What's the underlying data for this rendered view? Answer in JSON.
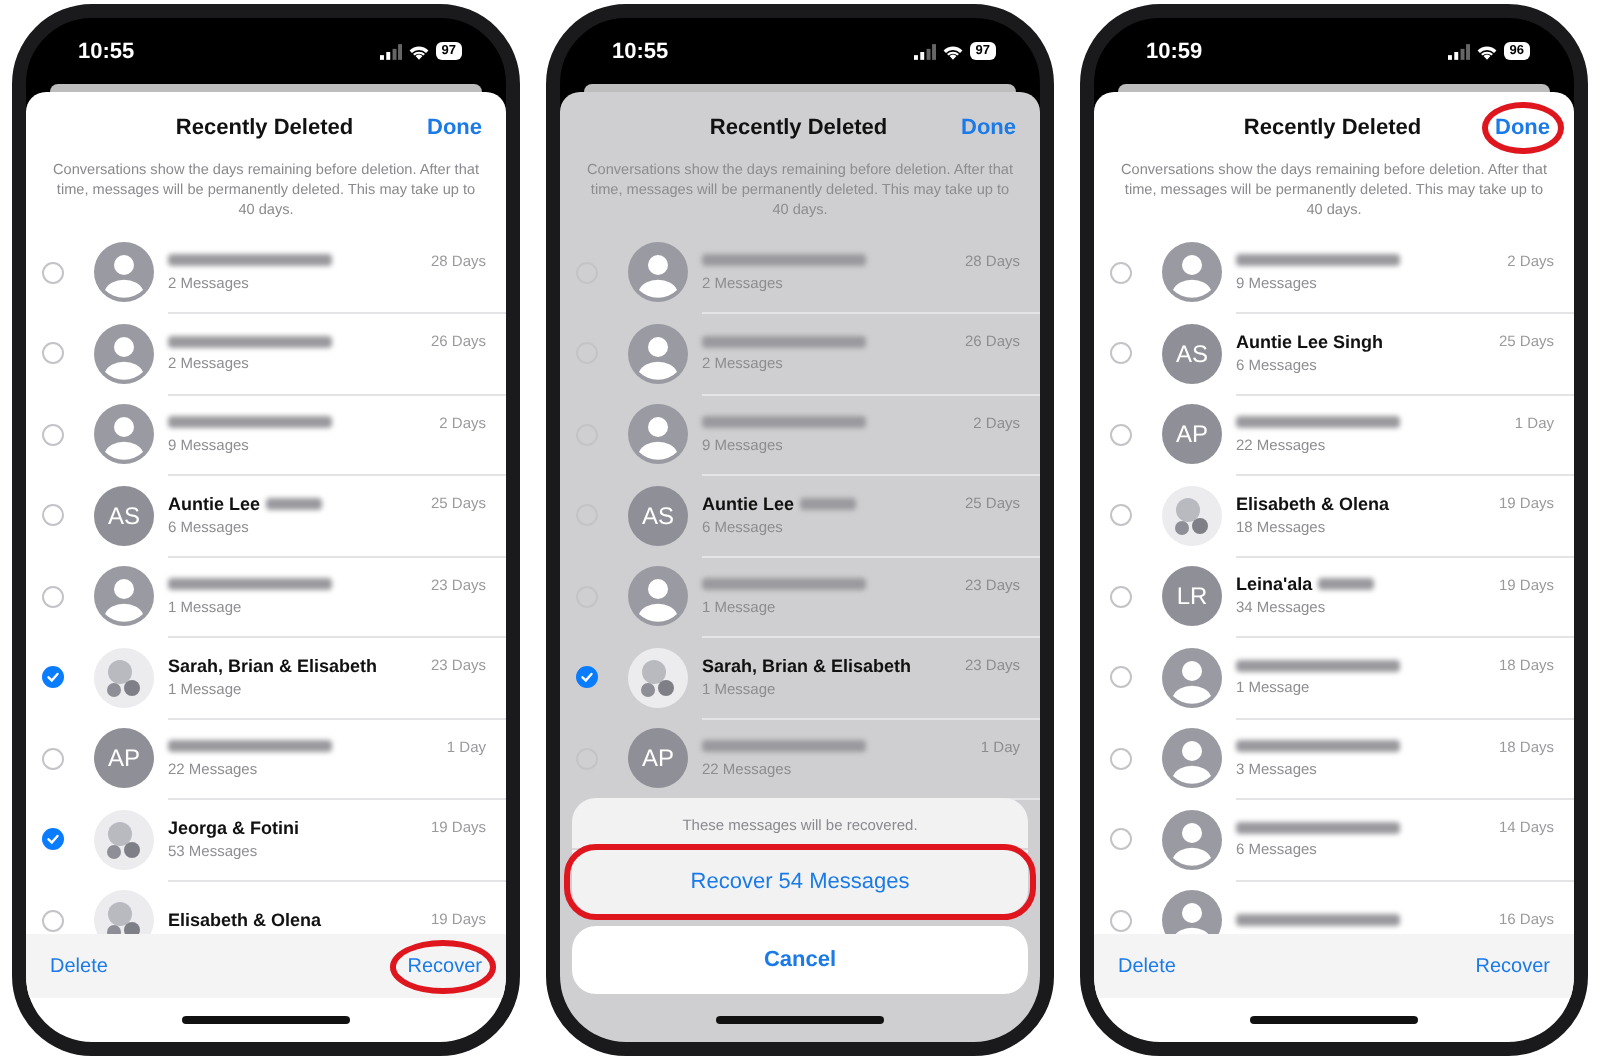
{
  "phones": [
    {
      "status_bar": {
        "time": "10:55",
        "battery": "97"
      },
      "dimmed": false,
      "title": "Recently Deleted",
      "done": {
        "label": "Done",
        "highlighted": false
      },
      "description": "Conversations show the days remaining before deletion. After that time, messages will be permanently deleted. This may take up to 40 days.",
      "rows": [
        {
          "name_blurred": true,
          "messages": "2 Messages",
          "days": "28 Days",
          "checked": false,
          "avatar": {
            "kind": "person"
          }
        },
        {
          "name_blurred": true,
          "messages": "2 Messages",
          "days": "26 Days",
          "checked": false,
          "avatar": {
            "kind": "person"
          }
        },
        {
          "name_blurred": true,
          "messages": "9 Messages",
          "days": "2 Days",
          "checked": false,
          "avatar": {
            "kind": "person"
          }
        },
        {
          "name": "Auntie Lee",
          "name_blurred": true,
          "messages": "6 Messages",
          "days": "25 Days",
          "checked": false,
          "avatar": {
            "kind": "initials",
            "initials": "AS"
          }
        },
        {
          "name_blurred": true,
          "messages": "1 Message",
          "days": "23 Days",
          "checked": false,
          "avatar": {
            "kind": "person"
          }
        },
        {
          "name": "Sarah, Brian & Elisabeth",
          "name_blurred": false,
          "messages": "1 Message",
          "days": "23 Days",
          "checked": true,
          "avatar": {
            "kind": "group"
          }
        },
        {
          "name_blurred": true,
          "messages": "22 Messages",
          "days": "1 Day",
          "checked": false,
          "avatar": {
            "kind": "initials",
            "initials": "AP"
          }
        },
        {
          "name": "Jeorga  & Fotini",
          "name_blurred": false,
          "messages": "53 Messages",
          "days": "19 Days",
          "checked": true,
          "avatar": {
            "kind": "group"
          }
        },
        {
          "name": "Elisabeth & Olena",
          "name_blurred": false,
          "days": "19 Days",
          "checked": false,
          "avatar": {
            "kind": "group"
          }
        }
      ],
      "toolbar": {
        "delete": {
          "label": "Delete"
        },
        "recover": {
          "label": "Recover",
          "highlighted": true
        }
      }
    },
    {
      "status_bar": {
        "time": "10:55",
        "battery": "97"
      },
      "dimmed": true,
      "title": "Recently Deleted",
      "done": {
        "label": "Done",
        "highlighted": false
      },
      "description": "Conversations show the days remaining before deletion. After that time, messages will be permanently deleted. This may take up to 40 days.",
      "rows": [
        {
          "name_blurred": true,
          "messages": "2 Messages",
          "days": "28 Days",
          "checked": false,
          "avatar": {
            "kind": "person"
          }
        },
        {
          "name_blurred": true,
          "messages": "2 Messages",
          "days": "26 Days",
          "checked": false,
          "avatar": {
            "kind": "person"
          }
        },
        {
          "name_blurred": true,
          "messages": "9 Messages",
          "days": "2 Days",
          "checked": false,
          "avatar": {
            "kind": "person"
          }
        },
        {
          "name": "Auntie Lee",
          "name_blurred": true,
          "messages": "6 Messages",
          "days": "25 Days",
          "checked": false,
          "avatar": {
            "kind": "initials",
            "initials": "AS"
          }
        },
        {
          "name_blurred": true,
          "messages": "1 Message",
          "days": "23 Days",
          "checked": false,
          "avatar": {
            "kind": "person"
          }
        },
        {
          "name": "Sarah, Brian & Elisabeth",
          "name_blurred": false,
          "messages": "1 Message",
          "days": "23 Days",
          "checked": true,
          "avatar": {
            "kind": "group"
          }
        },
        {
          "name_blurred": true,
          "messages": "22 Messages",
          "days": "1 Day",
          "checked": false,
          "avatar": {
            "kind": "initials",
            "initials": "AP"
          }
        }
      ],
      "action_sheet": {
        "message": "These messages will be recovered.",
        "action": {
          "label": "Recover 54 Messages",
          "highlighted": true
        },
        "cancel": {
          "label": "Cancel"
        }
      }
    },
    {
      "status_bar": {
        "time": "10:59",
        "battery": "96"
      },
      "dimmed": false,
      "title": "Recently Deleted",
      "done": {
        "label": "Done",
        "highlighted": true
      },
      "description": "Conversations show the days remaining before deletion. After that time, messages will be permanently deleted. This may take up to 40 days.",
      "rows": [
        {
          "name_blurred": true,
          "messages": "9 Messages",
          "days": "2 Days",
          "checked": false,
          "avatar": {
            "kind": "person"
          }
        },
        {
          "name": "Auntie Lee Singh",
          "name_blurred": false,
          "messages": "6 Messages",
          "days": "25 Days",
          "checked": false,
          "avatar": {
            "kind": "initials",
            "initials": "AS"
          }
        },
        {
          "name_blurred": true,
          "messages": "22 Messages",
          "days": "1 Day",
          "checked": false,
          "avatar": {
            "kind": "initials",
            "initials": "AP"
          }
        },
        {
          "name": "Elisabeth & Olena",
          "name_blurred": false,
          "messages": "18 Messages",
          "days": "19 Days",
          "checked": false,
          "avatar": {
            "kind": "group"
          }
        },
        {
          "name": "Leina'ala",
          "name_blurred": true,
          "messages": "34 Messages",
          "days": "19 Days",
          "checked": false,
          "avatar": {
            "kind": "initials",
            "initials": "LR"
          }
        },
        {
          "name_blurred": true,
          "messages": "1 Message",
          "days": "18 Days",
          "checked": false,
          "avatar": {
            "kind": "person"
          }
        },
        {
          "name_blurred": true,
          "messages": "3 Messages",
          "days": "18 Days",
          "checked": false,
          "avatar": {
            "kind": "person"
          }
        },
        {
          "name_blurred": true,
          "messages": "6 Messages",
          "days": "14 Days",
          "checked": false,
          "avatar": {
            "kind": "person"
          }
        },
        {
          "name_blurred": true,
          "days": "16 Days",
          "checked": false,
          "avatar": {
            "kind": "person"
          }
        }
      ],
      "toolbar": {
        "delete": {
          "label": "Delete"
        },
        "recover": {
          "label": "Recover",
          "highlighted": false
        }
      }
    }
  ]
}
